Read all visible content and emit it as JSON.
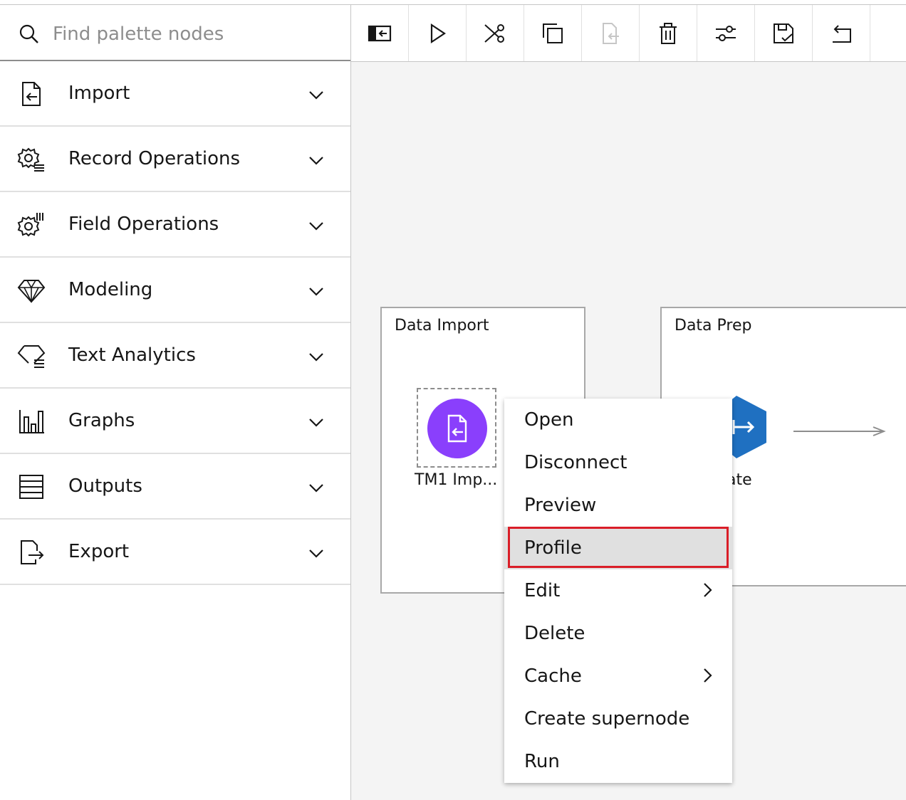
{
  "search": {
    "placeholder": "Find palette nodes"
  },
  "palette": [
    {
      "label": "Import",
      "icon": "import-icon"
    },
    {
      "label": "Record Operations",
      "icon": "record-operations-icon"
    },
    {
      "label": "Field Operations",
      "icon": "field-operations-icon"
    },
    {
      "label": "Modeling",
      "icon": "diamond-icon"
    },
    {
      "label": "Text Analytics",
      "icon": "text-analytics-icon"
    },
    {
      "label": "Graphs",
      "icon": "bar-chart-icon"
    },
    {
      "label": "Outputs",
      "icon": "table-icon"
    },
    {
      "label": "Export",
      "icon": "export-icon"
    }
  ],
  "toolbar": [
    "toggle-palette-icon",
    "run-icon",
    "cut-icon",
    "copy-icon",
    "paste-icon",
    "delete-icon",
    "settings-icon",
    "save-icon",
    "undo-icon"
  ],
  "canvas": {
    "groups": [
      {
        "title": "Data Import"
      },
      {
        "title": "Data Prep"
      }
    ],
    "nodes": [
      {
        "label": "TM1 Imp...",
        "color": "#8a3ffc"
      },
      {
        "label": "ate",
        "color": "#0f62fe"
      }
    ]
  },
  "context_menu": {
    "items": [
      {
        "label": "Open",
        "submenu": false
      },
      {
        "label": "Disconnect",
        "submenu": false
      },
      {
        "label": "Preview",
        "submenu": false
      },
      {
        "label": "Profile",
        "submenu": false,
        "highlighted": true
      },
      {
        "label": "Edit",
        "submenu": true
      },
      {
        "label": "Delete",
        "submenu": false
      },
      {
        "label": "Cache",
        "submenu": true
      },
      {
        "label": "Create supernode",
        "submenu": false
      },
      {
        "label": "Run",
        "submenu": false
      }
    ]
  },
  "colors": {
    "highlight_border": "#da1e28",
    "import_node": "#8a3ffc",
    "prep_node": "#1f70c1"
  }
}
